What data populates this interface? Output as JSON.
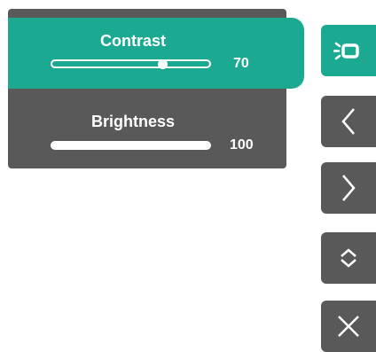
{
  "menu": {
    "items": [
      {
        "label": "Contrast",
        "value": "70",
        "level": 0.7,
        "active": true
      },
      {
        "label": "Brightness",
        "value": "100",
        "level": 1.0,
        "active": false
      }
    ]
  },
  "side_buttons": [
    {
      "icon": "input-source-icon",
      "active": true
    },
    {
      "icon": "chevron-left-icon",
      "active": false
    },
    {
      "icon": "chevron-right-icon",
      "active": false
    },
    {
      "icon": "up-down-icon",
      "active": false
    },
    {
      "icon": "close-icon",
      "active": false
    }
  ],
  "colors": {
    "accent": "#1ba992",
    "panel": "#595959",
    "text": "#ffffff"
  }
}
